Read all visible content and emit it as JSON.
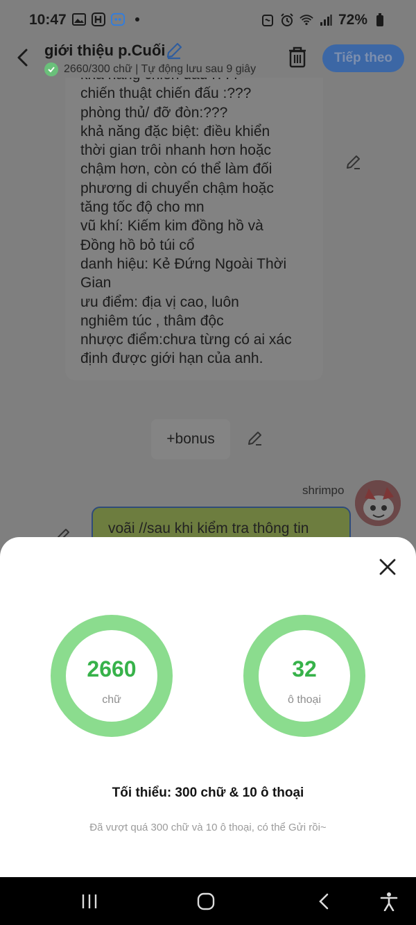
{
  "status_bar": {
    "time": "10:47",
    "battery_percent": "72%",
    "icons": [
      "gallery-icon",
      "app-h-icon",
      "app-blue-icon",
      "dot-icon",
      "nfc-icon",
      "alarm-icon",
      "wifi-icon",
      "signal-icon",
      "battery-icon"
    ]
  },
  "header": {
    "title": "giới thiệu p.Cuối",
    "subtitle": "2660/300 chữ | Tự động lưu sau 9 giây",
    "next_label": "Tiếp theo"
  },
  "chat": {
    "bubble_lines": [
      "khả năng chiến đấu :???",
      "chiến thuật chiến đấu :???",
      "phòng thủ/ đỡ đòn:???",
      "khả năng đặc biệt: điều khiển",
      "thời gian trôi nhanh hơn hoặc",
      "chậm hơn, còn có thể làm đối",
      "phương di chuyển chậm hoặc",
      "tăng tốc độ cho mn",
      "vũ khí: Kiếm kim đồng hồ và",
      "Đồng hồ bỏ túi cổ",
      "danh hiệu: Kẻ Đứng Ngoài Thời",
      "Gian",
      "ưu điểm:  địa vị cao, luôn",
      "nghiêm túc , thâm độc",
      "nhược điểm:chưa từng có ai xác",
      "định được giới hạn của anh."
    ],
    "bonus_label": "+bonus",
    "username": "shrimpo",
    "message_text": "voãi //sau khi kiểm tra thông tin"
  },
  "stats_sheet": {
    "words_value": "2660",
    "words_label": "chữ",
    "dialogs_value": "32",
    "dialogs_label": "ô thoại",
    "minimum_text": "Tối thiểu: 300 chữ & 10 ô thoại",
    "note_text": "Đã vượt quá 300 chữ và 10 ô thoại, có thể Gửi rồi~"
  },
  "colors": {
    "accent_blue": "#3c67a5",
    "ring_green": "#8bdc8e",
    "number_green": "#37b24a",
    "status_green": "#6ac07a"
  }
}
